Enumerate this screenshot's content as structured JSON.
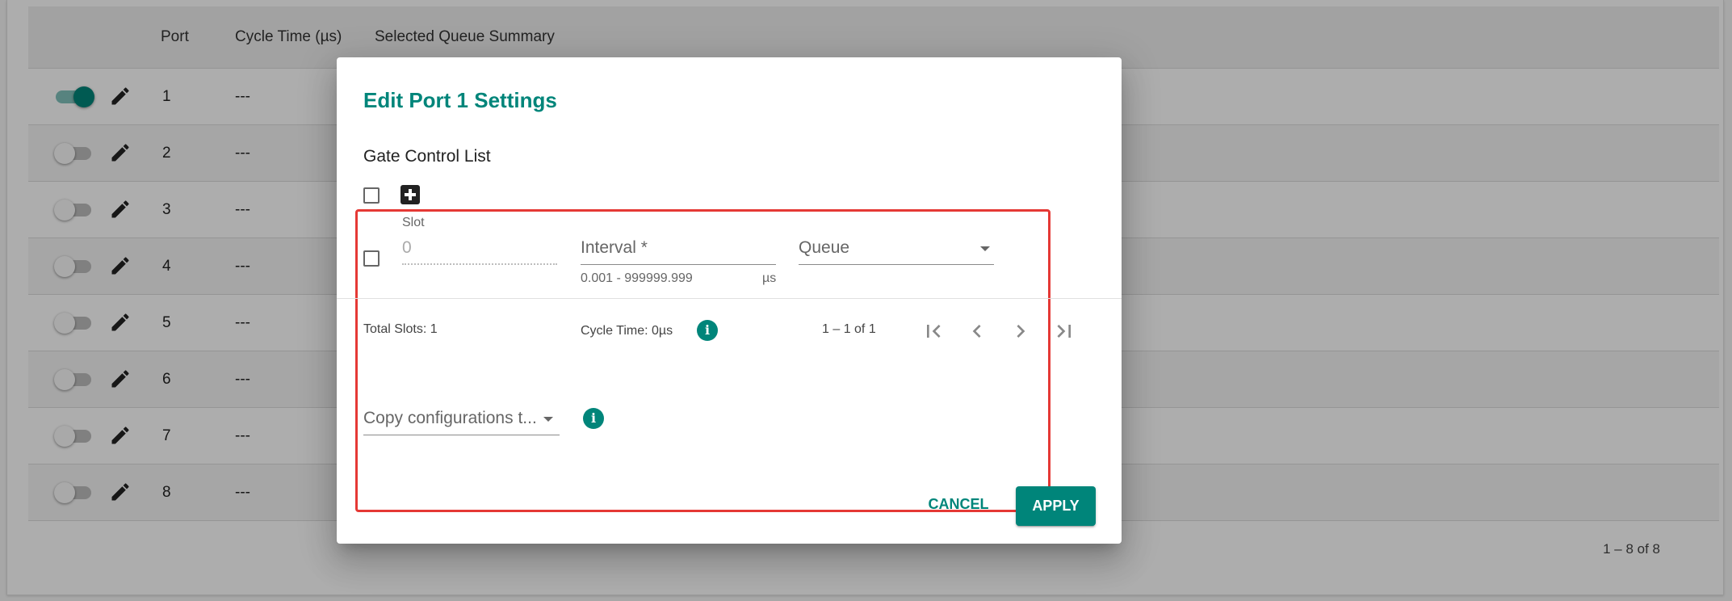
{
  "table": {
    "headers": {
      "port": "Port",
      "cycle_time": "Cycle Time (µs)",
      "queue_summary": "Selected Queue Summary"
    },
    "rows": [
      {
        "port": "1",
        "cycle_time": "---",
        "enabled": true
      },
      {
        "port": "2",
        "cycle_time": "---",
        "enabled": false
      },
      {
        "port": "3",
        "cycle_time": "---",
        "enabled": false
      },
      {
        "port": "4",
        "cycle_time": "---",
        "enabled": false
      },
      {
        "port": "5",
        "cycle_time": "---",
        "enabled": false
      },
      {
        "port": "6",
        "cycle_time": "---",
        "enabled": false
      },
      {
        "port": "7",
        "cycle_time": "---",
        "enabled": false
      },
      {
        "port": "8",
        "cycle_time": "---",
        "enabled": false
      }
    ],
    "paginator": "1 – 8 of 8"
  },
  "dialog": {
    "title": "Edit Port 1 Settings",
    "section_title": "Gate Control List",
    "slot": {
      "label": "Slot",
      "value": "0"
    },
    "interval": {
      "placeholder": "Interval *",
      "hint": "0.001 - 999999.999",
      "unit": "µs"
    },
    "queue": {
      "placeholder": "Queue"
    },
    "footer": {
      "total_slots": "Total Slots: 1",
      "cycle_time": "Cycle Time: 0µs",
      "range": "1 – 1 of 1"
    },
    "copy_config": {
      "placeholder": "Copy configurations t..."
    },
    "buttons": {
      "cancel": "Cancel",
      "apply": "Apply"
    }
  },
  "icons": {
    "edit": "pencil-icon",
    "add": "plus-box-icon",
    "info": "info-icon",
    "first_page": "first-page-icon",
    "prev_page": "chevron-left-icon",
    "next_page": "chevron-right-icon",
    "last_page": "last-page-icon"
  },
  "colors": {
    "accent": "#00857a",
    "highlight": "#e53935"
  }
}
